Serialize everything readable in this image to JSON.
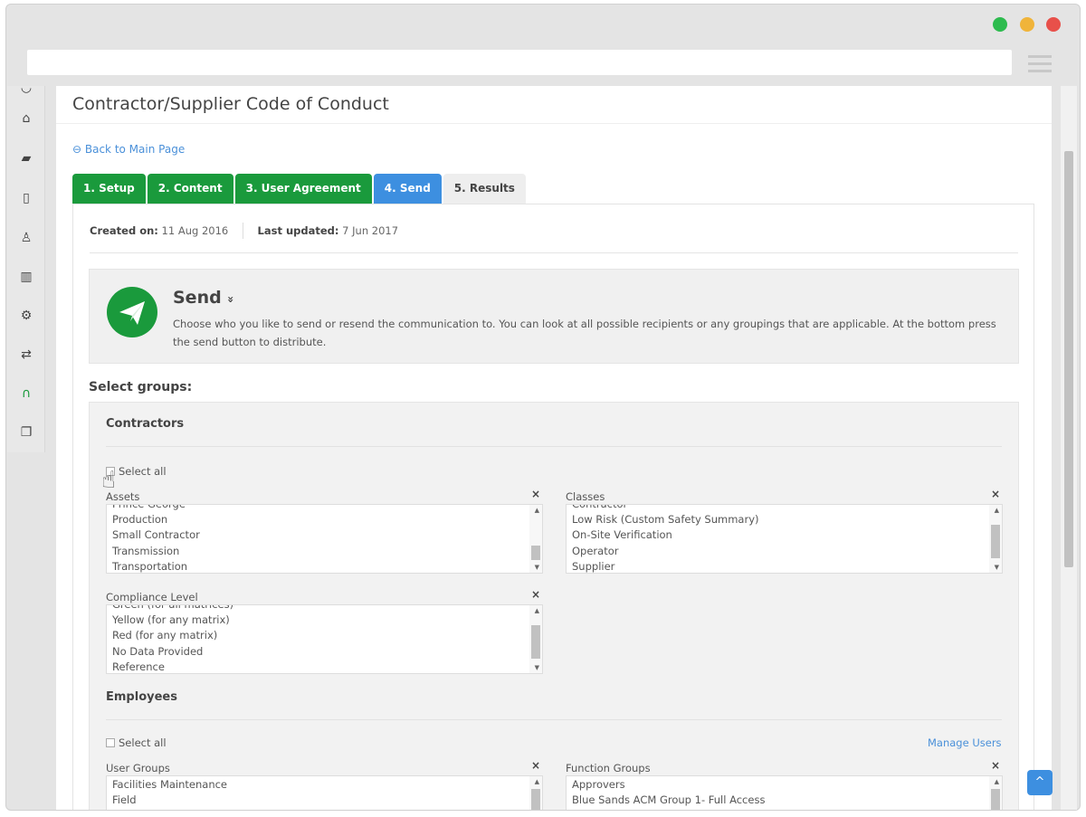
{
  "window": {
    "dots": [
      "#2dbb4e",
      "#f0b43a",
      "#e8504a"
    ]
  },
  "page": {
    "title": "Contractor/Supplier Code of Conduct",
    "back_link": "Back to Main Page"
  },
  "tabs": [
    {
      "label": "1. Setup",
      "color": "#1a9a3c"
    },
    {
      "label": "2. Content",
      "color": "#1a9a3c"
    },
    {
      "label": "3. User Agreement",
      "color": "#1a9a3c"
    },
    {
      "label": "4. Send",
      "color": "#3d8fe0"
    },
    {
      "label": "5. Results",
      "color": "#eeeeee"
    }
  ],
  "meta": {
    "created_label": "Created on:",
    "created": "11 Aug 2016",
    "updated_label": "Last updated:",
    "updated": "7 Jun 2017"
  },
  "send": {
    "title": "Send",
    "chevron": "»",
    "description": "Choose who you like to send or resend the communication to. You can look at all possible recipients or any groupings that are applicable. At the bottom press the send button to distribute."
  },
  "select_groups": "Select groups:",
  "contractors": {
    "heading": "Contractors",
    "select_all": "Select all",
    "assets": {
      "label": "Assets",
      "items": [
        "Prince George",
        "Production",
        "Small Contractor",
        "Transmission",
        "Transportation"
      ]
    },
    "classes": {
      "label": "Classes",
      "items": [
        "Contractor",
        "Low Risk (Custom Safety Summary)",
        "On-Site Verification",
        "Operator",
        "Supplier"
      ]
    },
    "compliance": {
      "label": "Compliance Level",
      "items": [
        "Green (for all matrices)",
        "Yellow (for any matrix)",
        "Red (for any matrix)",
        "No Data Provided",
        "Reference"
      ]
    }
  },
  "employees": {
    "heading": "Employees",
    "select_all": "Select all",
    "manage_users": "Manage Users",
    "user_groups": {
      "label": "User Groups",
      "items": [
        "Facilities Maintenance",
        "Field"
      ]
    },
    "function_groups": {
      "label": "Function Groups",
      "items": [
        "Approvers",
        "Blue Sands ACM Group 1- Full Access"
      ]
    }
  },
  "clear_icon": "×",
  "scroll_top": "^"
}
